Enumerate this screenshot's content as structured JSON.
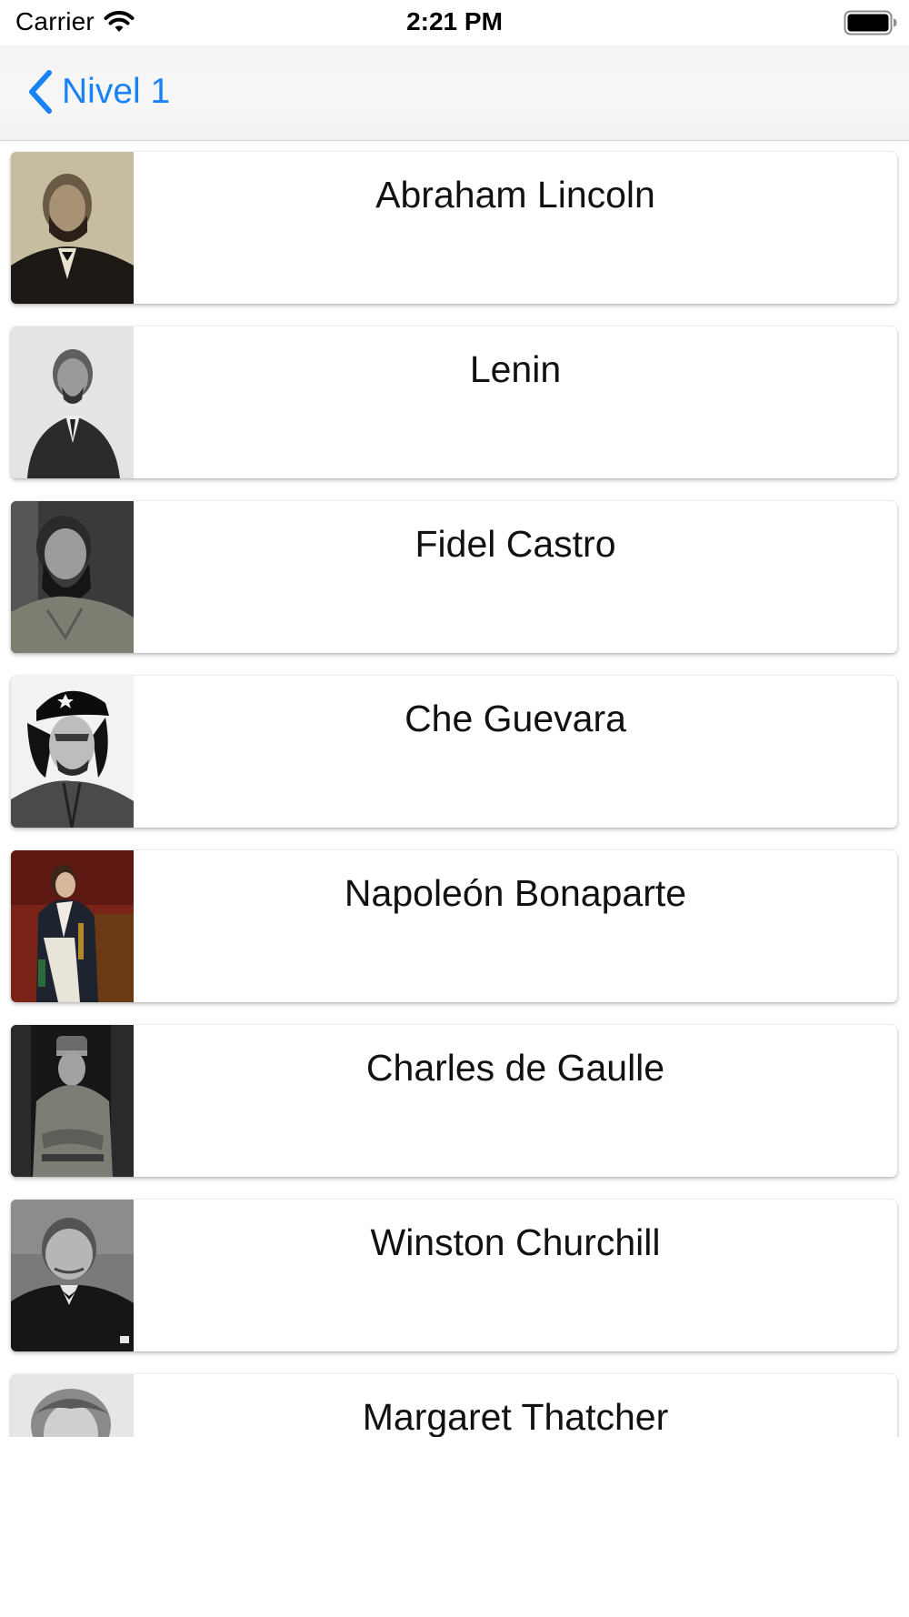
{
  "status_bar": {
    "carrier": "Carrier",
    "time": "2:21 PM"
  },
  "nav": {
    "back_label": "Nivel 1"
  },
  "colors": {
    "accent": "#1a82f7"
  },
  "people": [
    {
      "name": "Abraham Lincoln"
    },
    {
      "name": "Lenin"
    },
    {
      "name": "Fidel Castro"
    },
    {
      "name": "Che Guevara"
    },
    {
      "name": "Napoleón Bonaparte"
    },
    {
      "name": "Charles de Gaulle"
    },
    {
      "name": "Winston Churchill"
    },
    {
      "name": "Margaret Thatcher"
    }
  ]
}
